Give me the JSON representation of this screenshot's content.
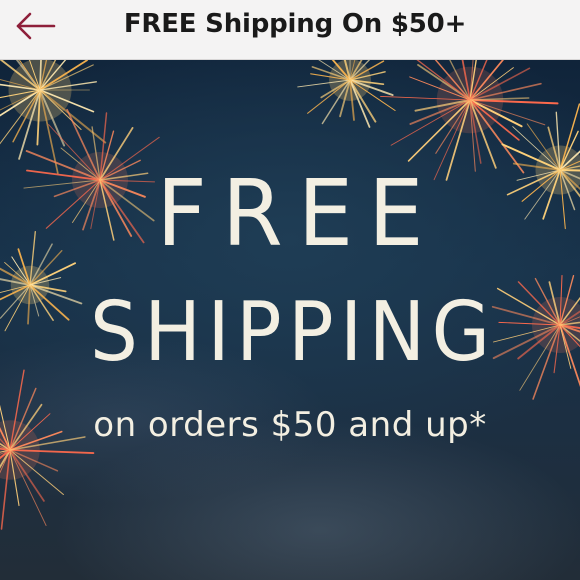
{
  "header": {
    "title": "FREE Shipping On $50+",
    "back_icon": "arrow-left-icon",
    "accent_color": "#8e1f3a"
  },
  "banner": {
    "headline_line1": "FREE",
    "headline_line2": "SHIPPING",
    "subline": "on orders $50 and up*",
    "text_color": "#f3efe2",
    "background_color": "#173149"
  }
}
